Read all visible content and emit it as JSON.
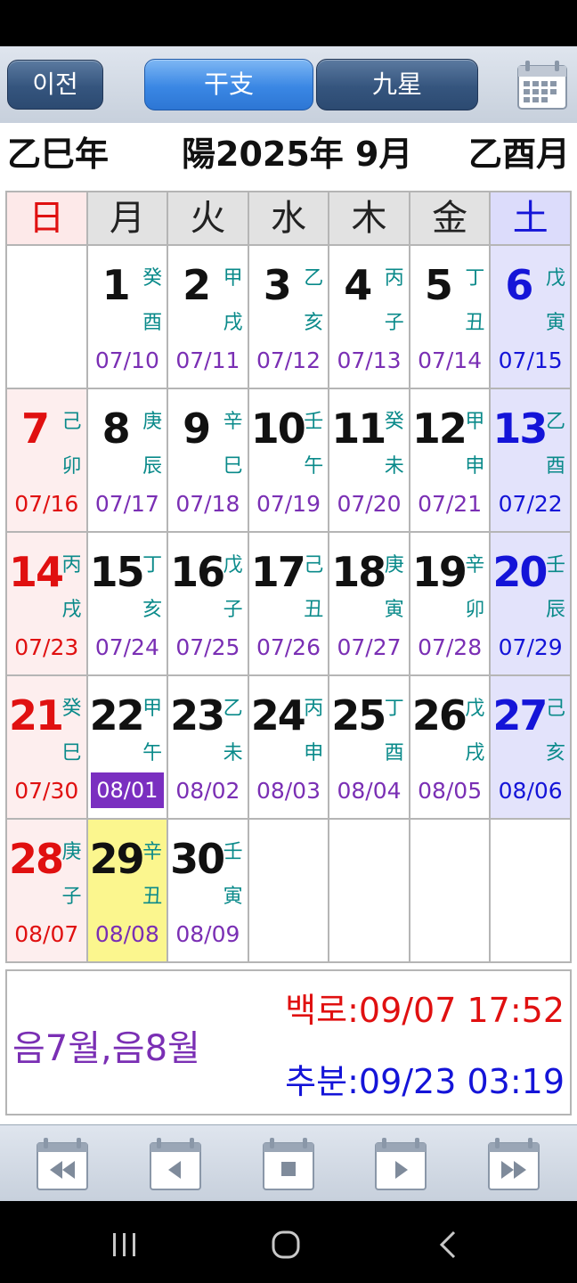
{
  "toolbar": {
    "prev_label": "이전",
    "tab1_label": "干支",
    "tab2_label": "九星",
    "calendar_icon": "calendar-icon"
  },
  "header": {
    "year_ganzhi": "乙巳年",
    "title": "陽2025年 9月",
    "month_ganzhi": "乙酉月"
  },
  "weekdays": [
    "日",
    "月",
    "火",
    "水",
    "木",
    "金",
    "土"
  ],
  "weeks": [
    [
      null,
      {
        "day": "1",
        "g1": "癸",
        "g2": "酉",
        "lunar": "07/10"
      },
      {
        "day": "2",
        "g1": "甲",
        "g2": "戌",
        "lunar": "07/11"
      },
      {
        "day": "3",
        "g1": "乙",
        "g2": "亥",
        "lunar": "07/12"
      },
      {
        "day": "4",
        "g1": "丙",
        "g2": "子",
        "lunar": "07/13"
      },
      {
        "day": "5",
        "g1": "丁",
        "g2": "丑",
        "lunar": "07/14"
      },
      {
        "day": "6",
        "g1": "戊",
        "g2": "寅",
        "lunar": "07/15"
      }
    ],
    [
      {
        "day": "7",
        "g1": "己",
        "g2": "卯",
        "lunar": "07/16"
      },
      {
        "day": "8",
        "g1": "庚",
        "g2": "辰",
        "lunar": "07/17"
      },
      {
        "day": "9",
        "g1": "辛",
        "g2": "巳",
        "lunar": "07/18"
      },
      {
        "day": "10",
        "g1": "壬",
        "g2": "午",
        "lunar": "07/19"
      },
      {
        "day": "11",
        "g1": "癸",
        "g2": "未",
        "lunar": "07/20"
      },
      {
        "day": "12",
        "g1": "甲",
        "g2": "申",
        "lunar": "07/21"
      },
      {
        "day": "13",
        "g1": "乙",
        "g2": "酉",
        "lunar": "07/22"
      }
    ],
    [
      {
        "day": "14",
        "g1": "丙",
        "g2": "戌",
        "lunar": "07/23"
      },
      {
        "day": "15",
        "g1": "丁",
        "g2": "亥",
        "lunar": "07/24"
      },
      {
        "day": "16",
        "g1": "戊",
        "g2": "子",
        "lunar": "07/25"
      },
      {
        "day": "17",
        "g1": "己",
        "g2": "丑",
        "lunar": "07/26"
      },
      {
        "day": "18",
        "g1": "庚",
        "g2": "寅",
        "lunar": "07/27"
      },
      {
        "day": "19",
        "g1": "辛",
        "g2": "卯",
        "lunar": "07/28"
      },
      {
        "day": "20",
        "g1": "壬",
        "g2": "辰",
        "lunar": "07/29"
      }
    ],
    [
      {
        "day": "21",
        "g1": "癸",
        "g2": "巳",
        "lunar": "07/30"
      },
      {
        "day": "22",
        "g1": "甲",
        "g2": "午",
        "lunar": "08/01",
        "lunar_highlight": true
      },
      {
        "day": "23",
        "g1": "乙",
        "g2": "未",
        "lunar": "08/02"
      },
      {
        "day": "24",
        "g1": "丙",
        "g2": "申",
        "lunar": "08/03"
      },
      {
        "day": "25",
        "g1": "丁",
        "g2": "酉",
        "lunar": "08/04"
      },
      {
        "day": "26",
        "g1": "戊",
        "g2": "戌",
        "lunar": "08/05"
      },
      {
        "day": "27",
        "g1": "己",
        "g2": "亥",
        "lunar": "08/06"
      }
    ],
    [
      {
        "day": "28",
        "g1": "庚",
        "g2": "子",
        "lunar": "08/07"
      },
      {
        "day": "29",
        "g1": "辛",
        "g2": "丑",
        "lunar": "08/08",
        "today": true
      },
      {
        "day": "30",
        "g1": "壬",
        "g2": "寅",
        "lunar": "08/09"
      },
      null,
      null,
      null,
      null
    ]
  ],
  "info": {
    "lunar_months": "음7월,음8월",
    "solar_term_1": "백로:09/07 17:52",
    "solar_term_2": "추분:09/23 03:19"
  },
  "colors": {
    "sunday": "#e01010",
    "saturday": "#1414d8",
    "lunar_text": "#7a2fb4",
    "ganzhi": "#0a8a8a",
    "today_bg": "#fbf68e",
    "new_moon_bg": "#7a2fc0",
    "active_tab": "#3a87e4"
  },
  "bottom_nav": {
    "icons": [
      "calendar-rewind-icon",
      "calendar-prev-icon",
      "calendar-stop-icon",
      "calendar-next-icon",
      "calendar-fast-forward-icon"
    ]
  },
  "system_nav": {
    "icons": [
      "recent-apps-icon",
      "home-icon",
      "back-icon"
    ]
  }
}
